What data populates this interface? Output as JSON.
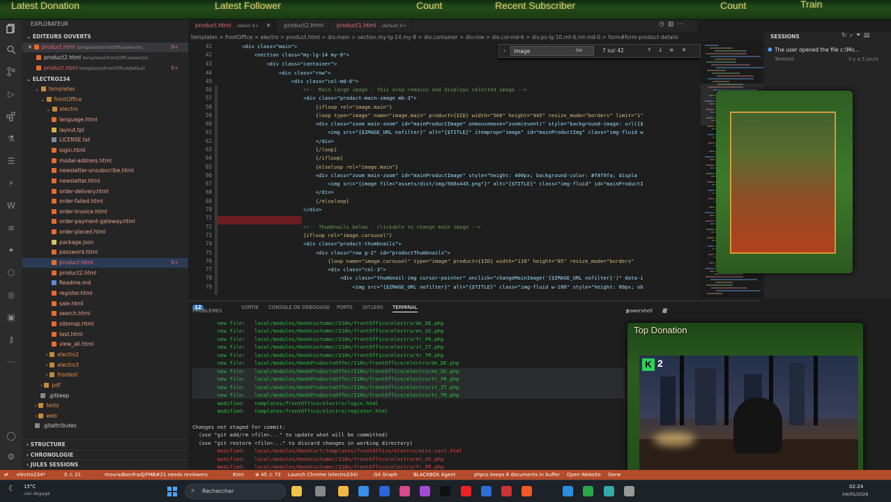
{
  "overlay_bar": {
    "labels": [
      "Latest Donation",
      "Latest Follower",
      "Count",
      "Recent Subscriber",
      "Count",
      "Train"
    ]
  },
  "editor_tabs": [
    {
      "label": "product.html",
      "extra": "...labels 9+",
      "active": true
    },
    {
      "label": "product2.html",
      "extra": "",
      "active": false
    },
    {
      "label": "product1.html",
      "extra": "...default 9+",
      "active": false
    }
  ],
  "breadcrumb": "templates > frontOffice > electro > product.html > div.main > section.my-lg-14.my-8 > div.container > div.row > div.col-md-6 > div.ps-lg-10.mt-6.mt-md-0 > form#form-product-details",
  "sidebar": {
    "title": "EXPLORATEUR",
    "open_editors_header": "ÉDITEURS OUVERTS",
    "open_editors": [
      {
        "name": "product.html",
        "path": "templates\\frontOffice\\electro",
        "badge": "9+"
      },
      {
        "name": "product2.html",
        "path": "templates\\frontOffice\\electro",
        "badge": ""
      },
      {
        "name": "product.html",
        "path": "templates\\frontOffice\\default",
        "badge": "9+"
      }
    ],
    "project": "ELECTRO234",
    "tree": [
      {
        "label": "templates",
        "depth": 1,
        "kind": "folder-open"
      },
      {
        "label": "frontOffice",
        "depth": 2,
        "kind": "folder-open"
      },
      {
        "label": "electro",
        "depth": 3,
        "kind": "folder-open"
      },
      {
        "label": "language.html",
        "depth": 4,
        "kind": "html"
      },
      {
        "label": "layout.tpl",
        "depth": 4,
        "kind": "tpl"
      },
      {
        "label": "LICENSE.txt",
        "depth": 4,
        "kind": "txt"
      },
      {
        "label": "login.html",
        "depth": 4,
        "kind": "html"
      },
      {
        "label": "modal-address.html",
        "depth": 4,
        "kind": "html"
      },
      {
        "label": "newsletter-unsubscribe.html",
        "depth": 4,
        "kind": "html"
      },
      {
        "label": "newsletter.html",
        "depth": 4,
        "kind": "html"
      },
      {
        "label": "order-delivery.html",
        "depth": 4,
        "kind": "html"
      },
      {
        "label": "order-failed.html",
        "depth": 4,
        "kind": "html"
      },
      {
        "label": "order-invoice.html",
        "depth": 4,
        "kind": "html"
      },
      {
        "label": "order-payment-gateway.html",
        "depth": 4,
        "kind": "html"
      },
      {
        "label": "order-placed.html",
        "depth": 4,
        "kind": "html"
      },
      {
        "label": "package.json",
        "depth": 4,
        "kind": "json"
      },
      {
        "label": "password.html",
        "depth": 4,
        "kind": "html"
      },
      {
        "label": "product.html",
        "depth": 4,
        "kind": "html",
        "badge": "9+"
      },
      {
        "label": "product2.html",
        "depth": 4,
        "kind": "html"
      },
      {
        "label": "Readme.md",
        "depth": 4,
        "kind": "md"
      },
      {
        "label": "register.html",
        "depth": 4,
        "kind": "html"
      },
      {
        "label": "sale.html",
        "depth": 4,
        "kind": "html"
      },
      {
        "label": "search.html",
        "depth": 4,
        "kind": "html"
      },
      {
        "label": "sitemap.html",
        "depth": 4,
        "kind": "html"
      },
      {
        "label": "test.html",
        "depth": 4,
        "kind": "html"
      },
      {
        "label": "view_all.html",
        "depth": 4,
        "kind": "html"
      },
      {
        "label": "electro2",
        "depth": 3,
        "kind": "folder"
      },
      {
        "label": "electro3",
        "depth": 3,
        "kind": "folder"
      },
      {
        "label": "frootest",
        "depth": 3,
        "kind": "folder"
      },
      {
        "label": "pdf",
        "depth": 2,
        "kind": "folder"
      },
      {
        "label": ".gitkeep",
        "depth": 2,
        "kind": "file"
      },
      {
        "label": "tests",
        "depth": 1,
        "kind": "folder"
      },
      {
        "label": "web",
        "depth": 1,
        "kind": "folder"
      },
      {
        "label": ".gitattributes",
        "depth": 1,
        "kind": "file"
      }
    ],
    "footer_sections": [
      "STRUCTURE",
      "CHRONOLOGIE",
      "JULES SESSIONS"
    ]
  },
  "find_widget": {
    "query": "image",
    "count": "7 sur 42"
  },
  "editor_lines": [
    {
      "n": "41",
      "text": "        <div class=\"main\">"
    },
    {
      "n": "42",
      "text": "            <section class=\"my-lg-14 my-8\">"
    },
    {
      "n": "43",
      "text": "                <div class=\"container\">"
    },
    {
      "n": "44",
      "text": "                    <div class=\"row\">"
    },
    {
      "n": "45",
      "text": "                        <div class=\"col-md-6\">"
    },
    {
      "n": "56",
      "text": "                            <!-- Main large image - this area remains and displays selected image -->"
    },
    {
      "n": "57",
      "text": "                            <div class=\"product-main-image mb-3\">"
    },
    {
      "n": "58",
      "text": "                                {ifloop rel=\"image.main\"}"
    },
    {
      "n": "59",
      "text": "                                {loop type=\"image\" name=\"image.main\" product={$ID} width=\"560\" height=\"445\" resize_mode=\"borders\" limit=\"1\""
    },
    {
      "n": "60",
      "text": "                                <div class=\"zoom main-zoom\" id=\"mainProductImage\" onmousemove=\"zoom(event)\" style=\"background-image: url({$"
    },
    {
      "n": "61",
      "text": "                                    <img src=\"{$IMAGE_URL nofilter}\" alt=\"{$TITLE}\" itemprop=\"image\" id=\"mainProductImg\" class=\"img-fluid w"
    },
    {
      "n": "62",
      "text": "                                </div>"
    },
    {
      "n": "63",
      "text": "                                {/loop}"
    },
    {
      "n": "64",
      "text": "                                {/ifloop}"
    },
    {
      "n": "65",
      "text": "                                {elseloop rel=\"image.main\"}"
    },
    {
      "n": "66",
      "text": "                                <div class=\"zoom main-zoom\" id=\"mainProductImage\" style=\"height: 400px; background-color: #f8f9fa; displa"
    },
    {
      "n": "67",
      "text": "                                    <img src=\"{image file=\"assets/dist/img/560x445.png\"}\" alt=\"{$TITLE}\" class=\"img-fluid\" id=\"mainProductI"
    },
    {
      "n": "68",
      "text": "                                </div>"
    },
    {
      "n": "69",
      "text": "                                {/elseloop}"
    },
    {
      "n": "70",
      "text": "                            </div>"
    },
    {
      "n": "71",
      "text": ""
    },
    {
      "n": "72",
      "text": "                            <!-- Thumbnails below - clickable to change main image -->"
    },
    {
      "n": "73",
      "text": "                            {ifloop rel=\"image.carousel\"}"
    },
    {
      "n": "74",
      "text": "                            <div class=\"product-thumbnails\">"
    },
    {
      "n": "75",
      "text": "                                <div class=\"row g-2\" id=\"productThumbnails\">"
    },
    {
      "n": "76",
      "text": "                                    {loop name=\"image.carousel\" type=\"image\" product={$ID} width=\"118\" height=\"85\" resize_mode=\"borders\""
    },
    {
      "n": "77",
      "text": "                                    <div class=\"col-3\">"
    },
    {
      "n": "78",
      "text": "                                        <div class=\"thumbnail-img cursor-pointer\" onclick=\"changeMainImage('{$IMAGE_URL nofilter}')\" data-i"
    },
    {
      "n": "79",
      "text": "                                            <img src=\"{$IMAGE_URL nofilter}\" alt=\"{$TITLE}\" class=\"img-fluid w-100\" style=\"height: 80px; ob"
    }
  ],
  "panel": {
    "tabs": [
      "PROBLÈMES",
      "SORTIE",
      "CONSOLE DE DÉBOGAGE",
      "PORTS",
      "GITLENS",
      "TERMINAL"
    ],
    "problems_count": "12",
    "shell": "powershell",
    "lines": [
      {
        "text": "        new file:   local/modules/HookCustomer/I18n/frontOffice/electro/de_DE.php",
        "c": "g"
      },
      {
        "text": "        new file:   local/modules/HookCustomer/I18n/frontOffice/electro/en_US.php",
        "c": "g"
      },
      {
        "text": "        new file:   local/modules/HookCustomer/I18n/frontOffice/electro/fr_FR.php",
        "c": "g"
      },
      {
        "text": "        new file:   local/modules/HookCustomer/I18n/frontOffice/electro/it_IT.php",
        "c": "g"
      },
      {
        "text": "        new file:   local/modules/HookCustomer/I18n/frontOffice/electro/tr_TR.php",
        "c": "g"
      },
      {
        "text": "        new file:   local/modules/HookProductsOffer/I18n/frontOffice/electro/de_DE.php",
        "c": "g"
      },
      {
        "text": "        new file:   local/modules/HookProductsOffer/I18n/frontOffice/electro/en_US.php",
        "c": "g"
      },
      {
        "text": "        new file:   local/modules/HookProductsOffer/I18n/frontOffice/electro/fr_FR.php",
        "c": "g"
      },
      {
        "text": "        new file:   local/modules/HookProductsOffer/I18n/frontOffice/electro/it_IT.php",
        "c": "g"
      },
      {
        "text": "        new file:   local/modules/HookProductsOffer/I18n/frontOffice/electro/tr_TR.php",
        "c": "g"
      },
      {
        "text": "        modified:   templates/frontOffice/electro/login.html",
        "c": "g"
      },
      {
        "text": "        modified:   templates/frontOffice/electro/register.html",
        "c": "g"
      },
      {
        "text": "",
        "c": "w"
      },
      {
        "text": "Changes not staged for commit:",
        "c": "w"
      },
      {
        "text": "  (use \"git add/rm <file>...\" to update what will be committed)",
        "c": "w"
      },
      {
        "text": "  (use \"git restore <file>...\" to discard changes in working directory)",
        "c": "w"
      },
      {
        "text": "        modified:   local/modules/HookCart/templates/frontOffice/electro/mini-cart.html",
        "c": "r"
      },
      {
        "text": "        modified:   local/modules/HookCustomer/I18n/frontOffice/electro/en_US.php",
        "c": "r"
      },
      {
        "text": "        modified:   local/modules/HookCustomer/I18n/frontOffice/electro/fr_FR.php",
        "c": "r"
      }
    ]
  },
  "sessions": {
    "title": "SESSIONS",
    "item": "The user opened the file c:\\Mo...",
    "status": "Terminé",
    "time": "il y a 5 jours"
  },
  "status_bar": {
    "items": [
      "electro234*",
      "0 ⚠ 21",
      "mouradbenfradj/FMB#21 needs reviewers",
      "Kimi",
      "⊗ 45 ⚠ 73",
      "Launch Chrome (electro234)",
      "Git Graph",
      "BLACKBOX Agent",
      "phpcs keeps 8 documents in buffer",
      "Open Website",
      "Gene"
    ]
  },
  "taskbar": {
    "weather_temp": "15°C",
    "weather_desc": "ciel dégagé",
    "search_placeholder": "Rechercher",
    "time": "02:24",
    "date": "04/05/2026"
  },
  "stream": {
    "top_donation_title": "Top Donation",
    "badge_text": "2"
  },
  "colors": {
    "accent_text": "#e8c878",
    "status_bar": "#b34b2a",
    "new_file": "#2bc246",
    "modified": "#e14444"
  }
}
